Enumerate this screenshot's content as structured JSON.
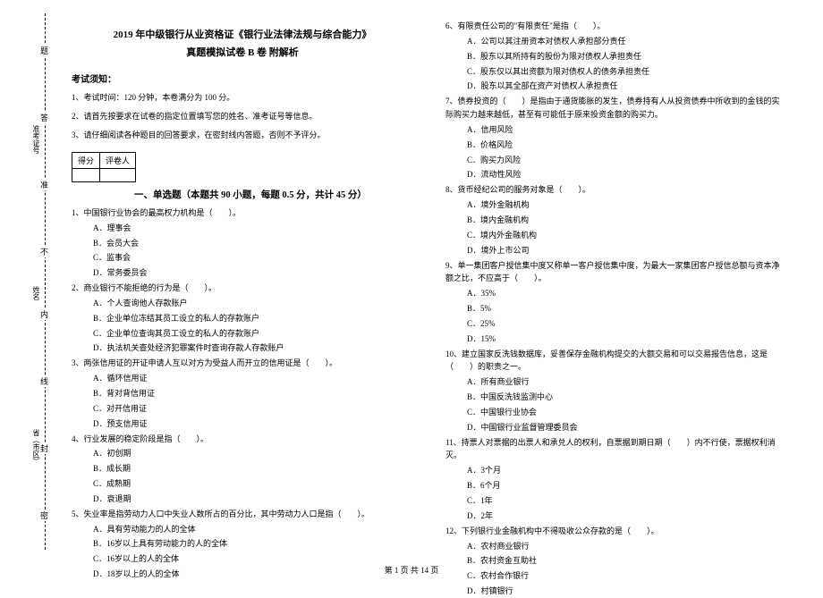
{
  "binding": {
    "labels": [
      "密",
      "封",
      "线",
      "内",
      "不",
      "准",
      "答",
      "题"
    ],
    "fold_fields": [
      "省（市区）",
      "姓名",
      "准考证号"
    ]
  },
  "title_line1": "2019 年中级银行从业资格证《银行业法律法规与综合能力》",
  "title_line2": "真题模拟试卷 B 卷 附解析",
  "notice_header": "考试须知：",
  "notice_items": [
    "1、考试时间：120 分钟，本卷满分为 100 分。",
    "2、请首先按要求在试卷的指定位置填写您的姓名、准考证号等信息。",
    "3、请仔细阅读各种题目的回答要求，在密封线内答题，否则不予评分。"
  ],
  "score_table": {
    "h1": "得分",
    "h2": "评卷人"
  },
  "section_title": "一、单选题（本题共 90 小题，每题 0.5 分，共计 45 分）",
  "left_questions": [
    {
      "stem": "1、中国银行业协会的最高权力机构是（　　）。",
      "options": [
        "A．理事会",
        "B．会员大会",
        "C．监事会",
        "D．常务委员会"
      ]
    },
    {
      "stem": "2、商业银行不能拒绝的行为是（　　）。",
      "options": [
        "A．个人查询他人存款账户",
        "B．企业单位冻结其员工设立的私人的存款账户",
        "C．企业单位查询其员工设立的私人的存款账户",
        "D．执法机关查处经济犯罪案件时查询存款人存款账户"
      ]
    },
    {
      "stem": "3、两张信用证的开证申请人互以对方为受益人而开立的信用证是（　　）。",
      "options": [
        "A．循环信用证",
        "B．背对背信用证",
        "C．对开信用证",
        "D．预支信用证"
      ]
    },
    {
      "stem": "4、行业发展的稳定阶段是指（　　）。",
      "options": [
        "A．初创期",
        "B．成长期",
        "C．成熟期",
        "D．衰退期"
      ]
    },
    {
      "stem": "5、失业率是指劳动力人口中失业人数所占的百分比，其中劳动力人口是指（　　）。",
      "options": [
        "A．具有劳动能力的人的全体",
        "B．16岁以上具有劳动能力的人的全体",
        "C．16岁以上的人的全体",
        "D．18岁以上的人的全体"
      ]
    }
  ],
  "right_questions": [
    {
      "stem": "6、有限责任公司的\"有限责任\"是指（　　）。",
      "options": [
        "A．公司以其注册资本对债权人承担部分责任",
        "B．股东以其所持有的股份为限对债权人承担责任",
        "C．股东仅以其出资额为限对债权人的债务承担责任",
        "D．股东以其全部在资产对债权人承担责任"
      ]
    },
    {
      "stem": "7、债券投资的（　　）是指由于通货膨胀的发生，债券持有人从投资债券中所收到的金钱的实际购买力越来越低，甚至有可能低于原来投资金额的购买力。",
      "options": [
        "A．信用风险",
        "B．价格风险",
        "C．购买力风险",
        "D．流动性风险"
      ]
    },
    {
      "stem": "8、货币经纪公司的服务对象是（　　）。",
      "options": [
        "A．境外金融机构",
        "B．境内金融机构",
        "C．境内外金融机构",
        "D．境外上市公司"
      ]
    },
    {
      "stem": "9、单一集团客户授信集中度又称单一客户授信集中度，为最大一家集团客户授信总额与资本净额之比，不应高于（　　）。",
      "options": [
        "A．35%",
        "B．5%",
        "C．25%",
        "D．15%"
      ]
    },
    {
      "stem": "10、建立国家反洗钱数据库，妥善保存金融机构提交的大额交易和可以交易报告信息，这是（　　）的职责之一。",
      "options": [
        "A．所有商业银行",
        "B．中国反洗钱监测中心",
        "C．中国银行业协会",
        "D．中国银行业监督管理委员会"
      ]
    },
    {
      "stem": "11、持票人对票据的出票人和承兑人的权利，自票据到期日期（　　）内不行使，票据权利消灭。",
      "options": [
        "A．3个月",
        "B．6个月",
        "C．1年",
        "D．2年"
      ]
    },
    {
      "stem": "12、下列银行业金融机构中不得吸收公众存款的是（　　）。",
      "options": [
        "A．农村商业银行",
        "B．农村资金互助社",
        "C．农村合作银行",
        "D．村镇银行"
      ]
    }
  ],
  "footer": "第 1 页 共 14 页"
}
